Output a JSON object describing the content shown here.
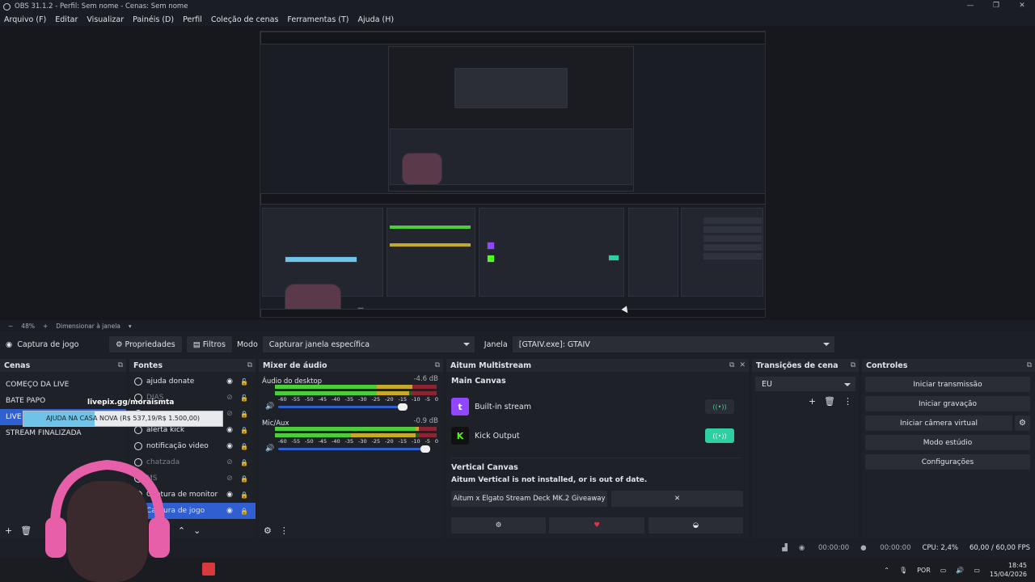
{
  "titlebar": {
    "title": "OBS 31.1.2 - Perfil: Sem nome - Cenas: Sem nome"
  },
  "menu": [
    "Arquivo (F)",
    "Editar",
    "Visualizar",
    "Painéis (D)",
    "Perfil",
    "Coleção de cenas",
    "Ferramentas (T)",
    "Ajuda (H)"
  ],
  "zoombar": {
    "zoom": "48%",
    "resize": "Dimensionar à janela"
  },
  "source_toolbar": {
    "source_name": "Captura de jogo",
    "properties": "Propriedades",
    "filters": "Filtros",
    "mode_label": "Modo",
    "mode_value": "Capturar janela específica",
    "window_label": "Janela",
    "window_value": "[GTAIV.exe]: GTAIV"
  },
  "scenes": {
    "title": "Cenas",
    "items": [
      "COMEÇO DA LIVE",
      "BATE PAPO",
      "LIVE",
      "STREAM FINALIZADA"
    ],
    "selected": "LIVE"
  },
  "sources": {
    "title": "Fontes",
    "items": [
      {
        "label": "ajuda donate",
        "visible": true
      },
      {
        "label": "DIAS",
        "visible": false
      },
      {
        "label": "",
        "visible": false
      },
      {
        "label": "alerta kick",
        "visible": true
      },
      {
        "label": "notificação video",
        "visible": true
      },
      {
        "label": "chatzada",
        "visible": false
      },
      {
        "label": "MS",
        "visible": true
      },
      {
        "label": "Captura de monitor",
        "visible": true
      },
      {
        "label": "Captura de jogo",
        "visible": true
      }
    ]
  },
  "mixer": {
    "title": "Mixer de áudio",
    "channels": [
      {
        "name": "Áudio do desktop",
        "db": "-4.6 dB"
      },
      {
        "name": "Mic/Aux",
        "db": "-0.9 dB"
      }
    ],
    "ticks": [
      "-60",
      "-55",
      "-50",
      "-45",
      "-40",
      "-35",
      "-30",
      "-25",
      "-20",
      "-15",
      "-10",
      "-5",
      "0"
    ]
  },
  "multistream": {
    "title": "Aitum Multistream",
    "main_canvas": "Main Canvas",
    "outputs": [
      {
        "name": "Built-in stream",
        "logo": "twitch-icon",
        "active": false
      },
      {
        "name": "Kick Output",
        "logo": "kick-icon",
        "active": true
      }
    ],
    "vertical_canvas": "Vertical Canvas",
    "vertical_warning": "Aitum Vertical is not installed, or is out of date.",
    "giveaway": "Aitum x Elgato Stream Deck MK.2 Giveaway"
  },
  "transitions": {
    "title": "Transições de cena",
    "selected": "EU"
  },
  "controls": {
    "title": "Controles",
    "buttons": [
      "Iniciar transmissão",
      "Iniciar gravação",
      "Iniciar câmera virtual",
      "Modo estúdio",
      "Configurações"
    ]
  },
  "status": {
    "rec_time": "00:00:00",
    "stream_time": "00:00:00",
    "cpu": "CPU: 2,4%",
    "fps": "60,00 / 60,00 FPS"
  },
  "taskbar": {
    "lang": "POR",
    "time": "18:45",
    "date": "15/04/2026"
  },
  "overlay": {
    "url": "livepix.gg/moraismta",
    "goal": "AJUDA NA CASA NOVA (R$ 537,19/R$ 1.500,00)",
    "progress": 0.358
  },
  "colors": {
    "accent": "#2f5fd0",
    "kick": "#53fc18",
    "twitch": "#9146ff",
    "active_output": "#2ecfa0"
  }
}
